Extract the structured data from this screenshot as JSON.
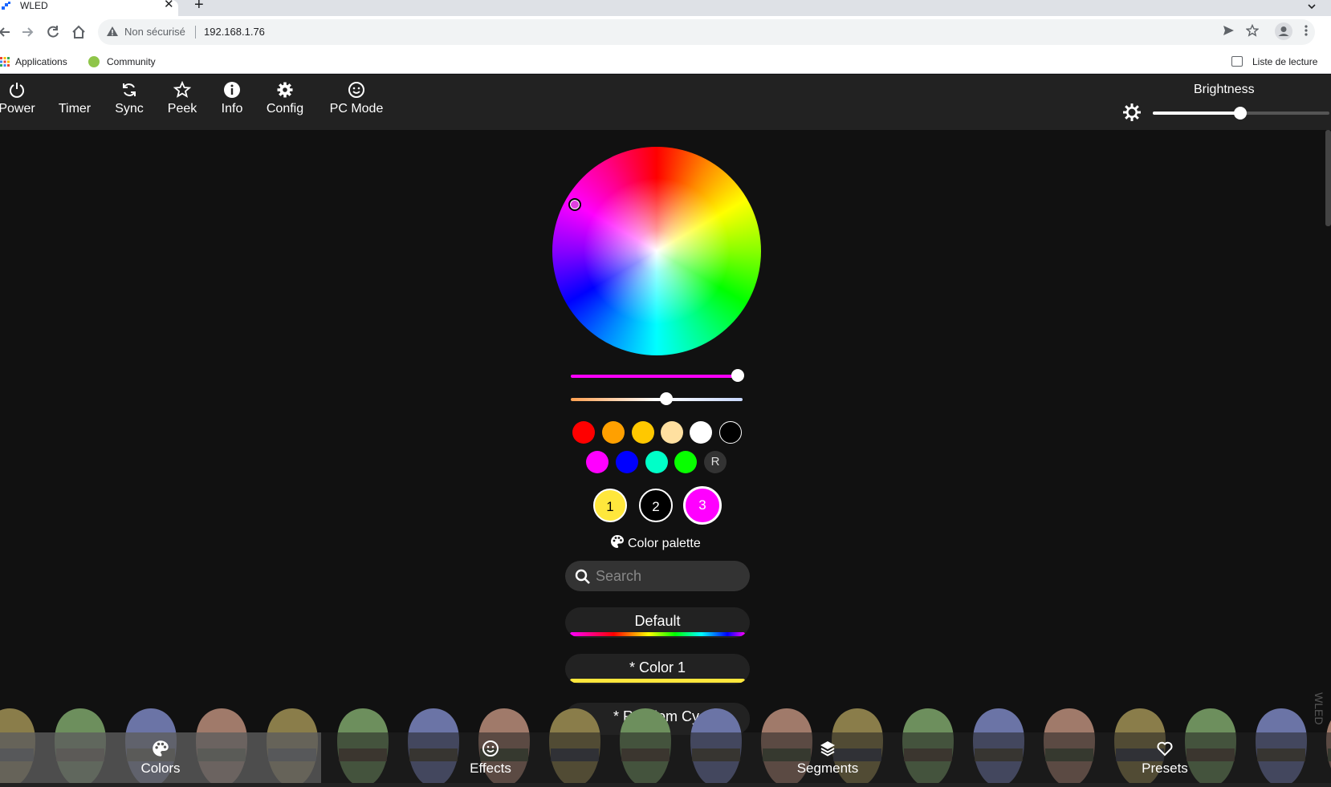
{
  "browser": {
    "tab_title": "WLED",
    "tab_close": "✕",
    "new_tab": "+",
    "security_label": "Non sécurisé",
    "url": "192.168.1.76",
    "bookmarks": [
      {
        "label": "Applications"
      },
      {
        "label": "Community"
      }
    ],
    "reading_list": "Liste de lecture"
  },
  "topbar": {
    "buttons": [
      {
        "label": "Power",
        "icon": "power-icon"
      },
      {
        "label": "Timer",
        "icon": "moon-icon"
      },
      {
        "label": "Sync",
        "icon": "sync-icon"
      },
      {
        "label": "Peek",
        "icon": "star-icon"
      },
      {
        "label": "Info",
        "icon": "info-icon"
      },
      {
        "label": "Config",
        "icon": "gear-icon"
      },
      {
        "label": "PC Mode",
        "icon": "smiley-icon"
      }
    ],
    "brightness_label": "Brightness",
    "brightness_value": 0.5
  },
  "colors": {
    "wheel_selected": "#e040e0",
    "hue_slider_value": 1.0,
    "cct_slider_value": 0.5,
    "quick_colors_row1": [
      "#ff0000",
      "#ffa000",
      "#ffc800",
      "#ffe0a0",
      "#ffffff",
      "#000000"
    ],
    "quick_colors_row2": [
      "#ff00ff",
      "#0000ff",
      "#00ffc8",
      "#08ff00"
    ],
    "random_label": "R",
    "slots": [
      {
        "label": "1",
        "color": "#ffe73c"
      },
      {
        "label": "2",
        "color": "#000000"
      },
      {
        "label": "3",
        "color": "#ff00ff"
      }
    ],
    "palette_header": "Color palette",
    "search_placeholder": "Search",
    "palettes": [
      {
        "name": "Default"
      },
      {
        "name": "* Color 1"
      },
      {
        "name": "* Random Cycle"
      }
    ]
  },
  "side_text": "WLED",
  "bottombar": {
    "tabs": [
      {
        "label": "Colors",
        "icon": "palette-icon",
        "active": true
      },
      {
        "label": "Effects",
        "icon": "smiley-icon",
        "active": false
      },
      {
        "label": "Segments",
        "icon": "layers-icon",
        "active": false
      },
      {
        "label": "Presets",
        "icon": "heart-icon",
        "active": false
      }
    ]
  }
}
